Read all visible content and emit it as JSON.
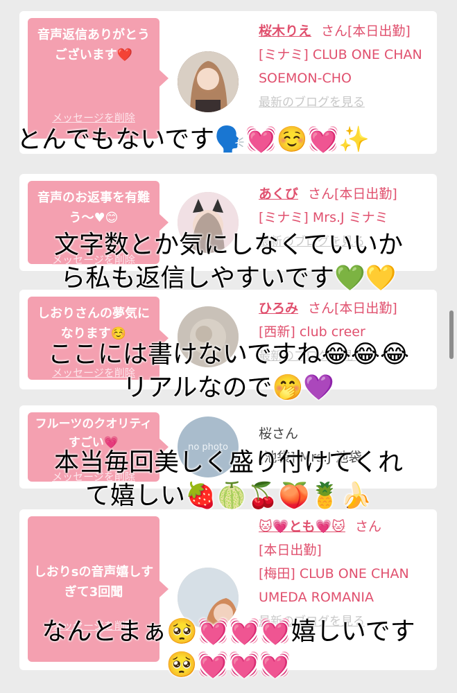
{
  "delete_label": "メッセージを削除",
  "blog_label": "最新のブログを見る",
  "cards": [
    {
      "message": "音声返信ありがとうございます❤️",
      "name": "桜木りえ",
      "san": "さん[本日出勤]",
      "store": "[ミナミ] CLUB ONE CHAN SOEMON-CHO",
      "avatar_icon": "woman-photo-icon"
    },
    {
      "message": "音声のお返事を有難う～♥😊",
      "name": "あくび",
      "san": "さん[本日出勤]",
      "store": "[ミナミ] Mrs.J ミナミ",
      "avatar_icon": "woman-cat-ears-photo-icon"
    },
    {
      "message": "しおりさんの夢気になります☺️",
      "name": "ひろみ",
      "san": "さん[本日出勤]",
      "store": "[西新] club creer",
      "avatar_icon": "blurred-photo-icon"
    },
    {
      "message": "フルーツのクオリティすごい💗",
      "name": "桜さん",
      "store": "[池袋] Mrs.J 池袋",
      "avatar_icon": "no-photo-icon",
      "avatar_text": "no photo"
    },
    {
      "message": "しおりsの音声嬉しすぎて3回聞",
      "name": "🐱💗とも💗🐱",
      "san": "さん",
      "status": "[本日出勤]",
      "store": "[梅田] CLUB ONE CHAN UMEDA ROMANIA",
      "avatar_icon": "woman-photo-icon"
    }
  ],
  "overlays": [
    "とんでもないです🗣️💓☺️💓✨",
    "文字数とか気にしなくていいか",
    "ら私も返信しやすいです💚💛",
    "ここには書けないですね😂😂😂",
    "リアルなので🤭💜",
    "本当毎回美しく盛り付けてくれ",
    "て嬉しい🍓🍈🍒🍑🍍🍌",
    "なんとまぁ🥺💓💓💓嬉しいです",
    "🥺💓💓💓"
  ]
}
